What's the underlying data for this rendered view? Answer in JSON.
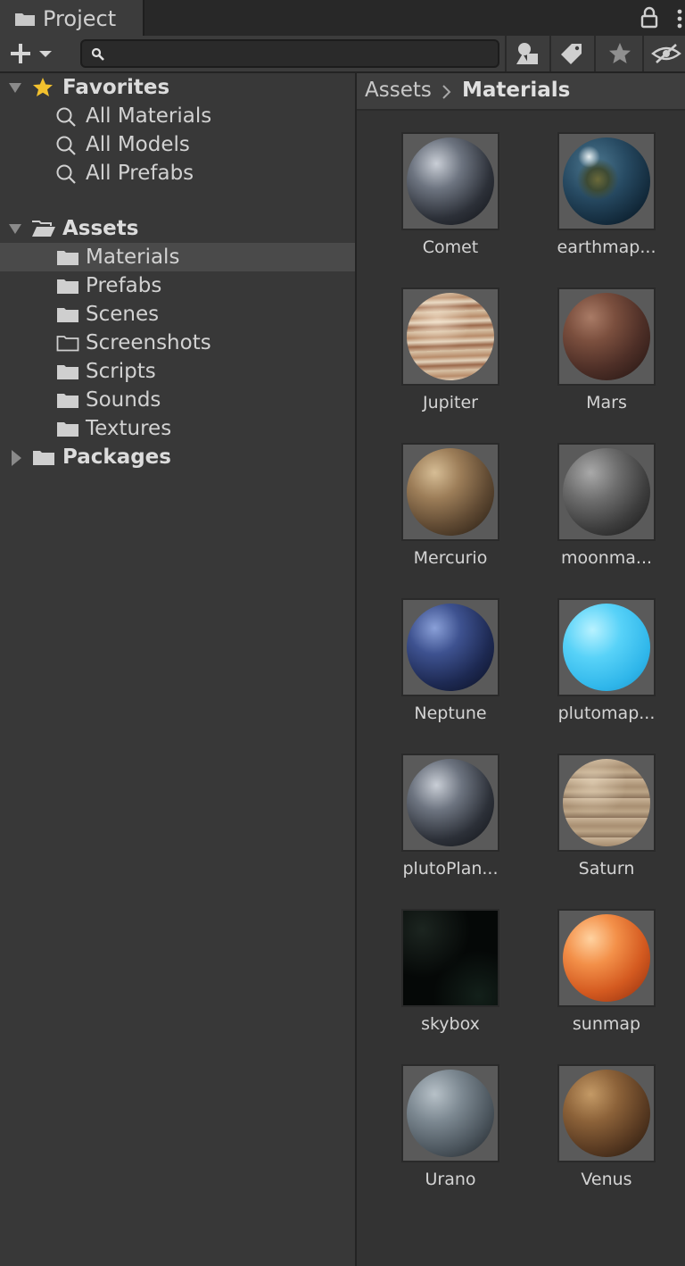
{
  "window": {
    "tab_title": "Project"
  },
  "toolbar": {
    "search_value": "",
    "search_placeholder": ""
  },
  "tree": {
    "favorites": {
      "label": "Favorites",
      "items": [
        "All Materials",
        "All Models",
        "All Prefabs"
      ]
    },
    "assets": {
      "label": "Assets",
      "folders": [
        "Materials",
        "Prefabs",
        "Scenes",
        "Screenshots",
        "Scripts",
        "Sounds",
        "Textures"
      ],
      "selected": "Materials",
      "empty_folders": [
        "Screenshots"
      ]
    },
    "packages": {
      "label": "Packages"
    }
  },
  "breadcrumb": {
    "root": "Assets",
    "current": "Materials"
  },
  "materials": [
    {
      "name": "Comet",
      "preview": "comet"
    },
    {
      "name": "earthmap...",
      "preview": "earth"
    },
    {
      "name": "Jupiter",
      "preview": "jupiter"
    },
    {
      "name": "Mars",
      "preview": "mars"
    },
    {
      "name": "Mercurio",
      "preview": "mercury"
    },
    {
      "name": "moonma...",
      "preview": "moon"
    },
    {
      "name": "Neptune",
      "preview": "neptune"
    },
    {
      "name": "plutomap...",
      "preview": "pluto"
    },
    {
      "name": "plutoPlan...",
      "preview": "comet"
    },
    {
      "name": "Saturn",
      "preview": "saturn"
    },
    {
      "name": "skybox",
      "preview": "skybox"
    },
    {
      "name": "sunmap",
      "preview": "sun"
    },
    {
      "name": "Urano",
      "preview": "uranus"
    },
    {
      "name": "Venus",
      "preview": "venus"
    }
  ],
  "colors": {
    "panel": "#383838",
    "selection": "#4a4a4a",
    "star": "#f2c12e",
    "text": "#d2d2d2"
  }
}
